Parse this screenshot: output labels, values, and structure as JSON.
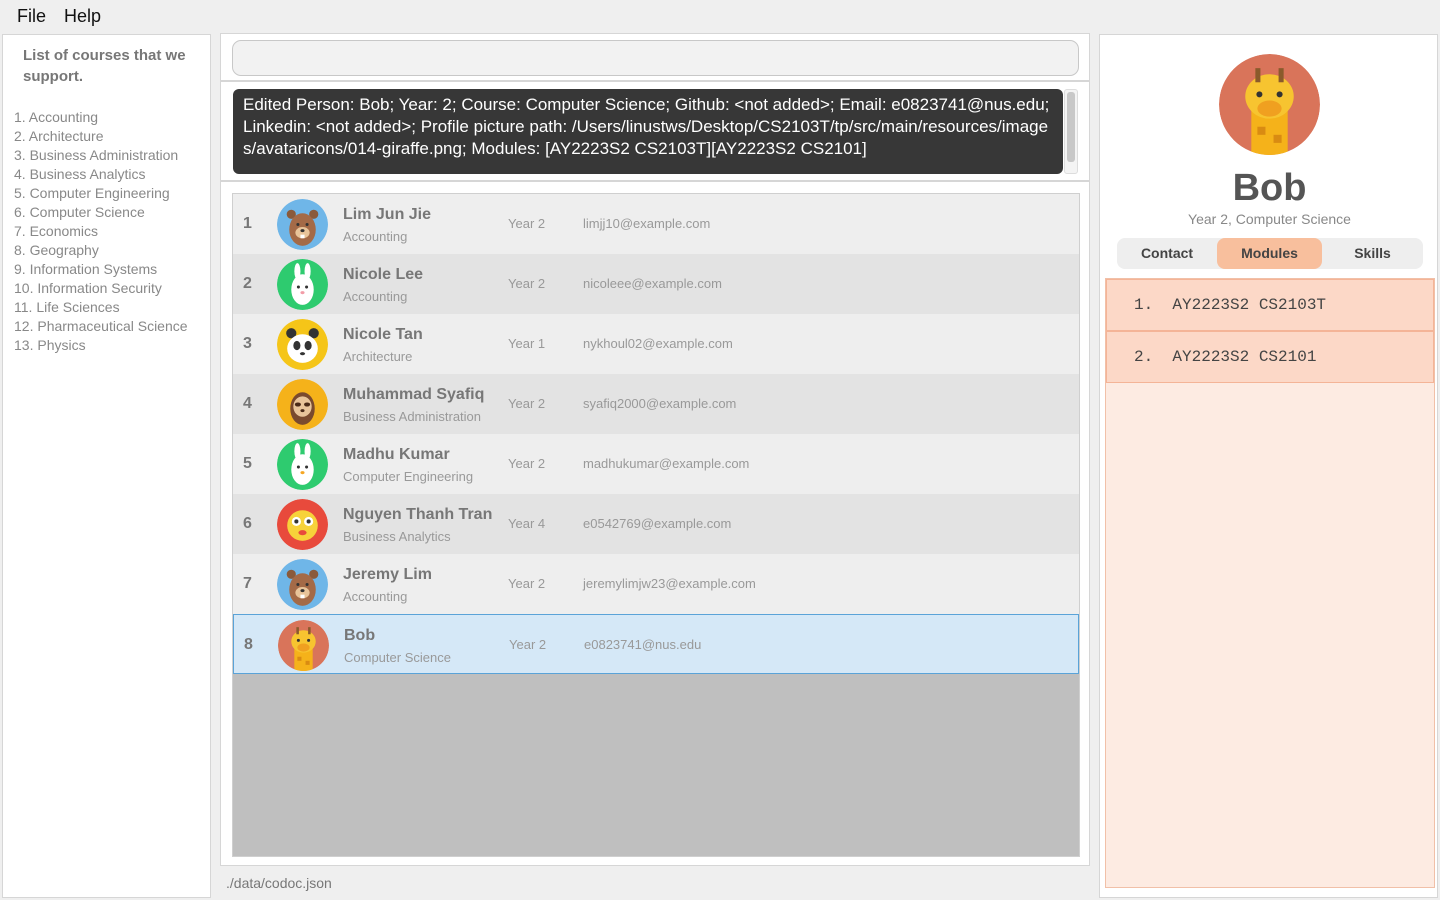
{
  "menu": {
    "file": "File",
    "help": "Help"
  },
  "courses": {
    "title": "List of courses that we support.",
    "items": [
      "1. Accounting",
      "2. Architecture",
      "3. Business Administration",
      "4. Business Analytics",
      "5. Computer Engineering",
      "6. Computer Science",
      "7. Economics",
      "8. Geography",
      "9. Information Systems",
      "10. Information Security",
      "11. Life Sciences",
      "12. Pharmaceutical Science",
      "13. Physics"
    ]
  },
  "command": {
    "value": "",
    "placeholder": ""
  },
  "result": {
    "text": "Edited Person: Bob; Year: 2; Course: Computer Science; Github: <not added>; Email: e0823741@nus.edu; Linkedin: <not added>; Profile picture path: /Users/linustws/Desktop/CS2103T/tp/src/main/resources/images/avataricons/014-giraffe.png; Modules: [AY2223S2 CS2103T][AY2223S2 CS2101]"
  },
  "persons": [
    {
      "index": "1",
      "name": "Lim Jun Jie",
      "course": "Accounting",
      "year": "Year 2",
      "email": "limjj10@example.com",
      "avatar": "bear-icon",
      "color": "#6fb6e8"
    },
    {
      "index": "2",
      "name": "Nicole Lee",
      "course": "Accounting",
      "year": "Year 2",
      "email": "nicoleee@example.com",
      "avatar": "rabbit-icon",
      "color": "#2ecb6f"
    },
    {
      "index": "3",
      "name": "Nicole Tan",
      "course": "Architecture",
      "year": "Year 1",
      "email": "nykhoul02@example.com",
      "avatar": "panda-icon",
      "color": "#f5c518"
    },
    {
      "index": "4",
      "name": "Muhammad Syafiq",
      "course": "Business Administration",
      "year": "Year 2",
      "email": "syafiq2000@example.com",
      "avatar": "sloth-icon",
      "color": "#f5b21a"
    },
    {
      "index": "5",
      "name": "Madhu Kumar",
      "course": "Computer Engineering",
      "year": "Year 2",
      "email": "madhukumar@example.com",
      "avatar": "chicken-icon",
      "color": "#2ecb6f"
    },
    {
      "index": "6",
      "name": "Nguyen Thanh Tran",
      "course": "Business Analytics",
      "year": "Year 4",
      "email": "e0542769@example.com",
      "avatar": "pufferfish-icon",
      "color": "#e84a3c"
    },
    {
      "index": "7",
      "name": "Jeremy Lim",
      "course": "Accounting",
      "year": "Year 2",
      "email": "jeremylimjw23@example.com",
      "avatar": "beaver-icon",
      "color": "#6fb6e8"
    },
    {
      "index": "8",
      "name": "Bob",
      "course": "Computer Science",
      "year": "Year 2",
      "email": "e0823741@nus.edu",
      "avatar": "giraffe-icon",
      "color": "#d9745a",
      "selected": true
    }
  ],
  "status": {
    "path": "./data/codoc.json"
  },
  "detail": {
    "name": "Bob",
    "subtitle": "Year 2, Computer Science",
    "avatar": "giraffe-icon",
    "tabs": [
      "Contact",
      "Modules",
      "Skills"
    ],
    "active_tab": "Modules",
    "modules": [
      "1.  AY2223S2 CS2103T",
      "2.  AY2223S2 CS2101"
    ]
  },
  "colors": {
    "accent_tab": "#f8bf9d",
    "module_bg": "#fcd8c7",
    "result_bg": "#373737",
    "selected_row": "#d5e8f7"
  }
}
